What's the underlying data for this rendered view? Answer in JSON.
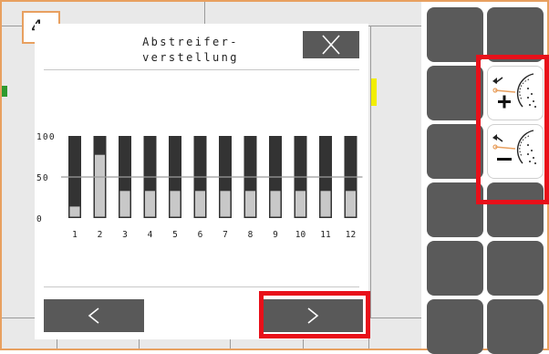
{
  "step_badge": "4",
  "dialog": {
    "title_line1": "Abstreifer-",
    "title_line2": "verstellung",
    "close_icon": "close-x-icon",
    "prev_icon": "chevron-left-icon",
    "next_icon": "chevron-right-icon"
  },
  "chart_data": {
    "type": "bar",
    "categories": [
      "1",
      "2",
      "3",
      "4",
      "5",
      "6",
      "7",
      "8",
      "9",
      "10",
      "11",
      "12"
    ],
    "values": [
      14,
      77,
      33,
      33,
      33,
      33,
      33,
      33,
      33,
      33,
      33,
      33
    ],
    "yticks": [
      "100",
      "50",
      "0"
    ],
    "ylim": [
      0,
      100
    ],
    "reference_line": 50,
    "colors": {
      "filled": "#c8c8c8",
      "empty": "#333333",
      "reference": "#9a9a9a"
    }
  },
  "right_panel": {
    "increase_button_icon": "scraper-plus-icon",
    "decrease_button_icon": "scraper-minus-icon"
  },
  "highlight_color": "#e8101a",
  "badge_color": "#e8a060"
}
